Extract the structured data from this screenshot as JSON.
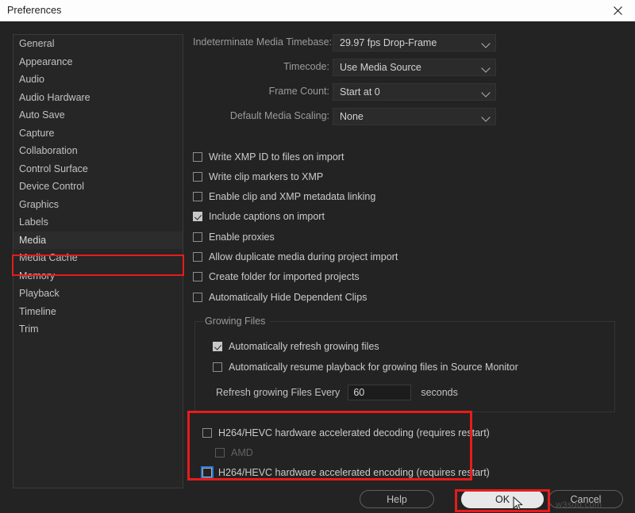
{
  "window": {
    "title": "Preferences",
    "close_icon": "close-icon"
  },
  "sidebar": {
    "items": [
      {
        "label": "General"
      },
      {
        "label": "Appearance"
      },
      {
        "label": "Audio"
      },
      {
        "label": "Audio Hardware"
      },
      {
        "label": "Auto Save"
      },
      {
        "label": "Capture"
      },
      {
        "label": "Collaboration"
      },
      {
        "label": "Control Surface"
      },
      {
        "label": "Device Control"
      },
      {
        "label": "Graphics"
      },
      {
        "label": "Labels"
      },
      {
        "label": "Media"
      },
      {
        "label": "Media Cache"
      },
      {
        "label": "Memory"
      },
      {
        "label": "Playback"
      },
      {
        "label": "Timeline"
      },
      {
        "label": "Trim"
      }
    ],
    "selected": "Media"
  },
  "fields": [
    {
      "label": "Indeterminate Media Timebase:",
      "value": "29.97 fps Drop-Frame"
    },
    {
      "label": "Timecode:",
      "value": "Use Media Source"
    },
    {
      "label": "Frame Count:",
      "value": "Start at 0"
    },
    {
      "label": "Default Media Scaling:",
      "value": "None"
    }
  ],
  "checkboxes": [
    {
      "label": "Write XMP ID to files on import",
      "checked": false
    },
    {
      "label": "Write clip markers to XMP",
      "checked": false
    },
    {
      "label": "Enable clip and XMP metadata linking",
      "checked": false
    },
    {
      "label": "Include captions on import",
      "checked": true
    },
    {
      "label": "Enable proxies",
      "checked": false
    },
    {
      "label": "Allow duplicate media during project import",
      "checked": false
    },
    {
      "label": "Create folder for imported projects",
      "checked": false
    },
    {
      "label": "Automatically Hide Dependent Clips",
      "checked": false
    }
  ],
  "growing_files": {
    "title": "Growing Files",
    "checkboxes": [
      {
        "label": "Automatically refresh growing files",
        "checked": true
      },
      {
        "label": "Automatically resume playback for growing files in Source Monitor",
        "checked": false
      }
    ],
    "refresh_label": "Refresh growing Files Every",
    "refresh_value": "60",
    "refresh_placeholder": "60",
    "seconds_label": "seconds"
  },
  "hardware": [
    {
      "label": "H264/HEVC hardware accelerated decoding (requires restart)",
      "checked": false,
      "disabled": false,
      "focused": false
    },
    {
      "label": "AMD",
      "checked": false,
      "disabled": true,
      "focused": false
    },
    {
      "label": "H264/HEVC hardware accelerated encoding (requires restart)",
      "checked": false,
      "disabled": false,
      "focused": true
    }
  ],
  "footer": {
    "help_label": "Help",
    "ok_label": "OK",
    "cancel_label": "Cancel"
  },
  "annotations": {
    "media_highlight_color": "#e81b1b",
    "hardware_highlight_color": "#e81b1b",
    "ok_highlight_color": "#e81b1b",
    "focus_color": "#2b77d6"
  },
  "watermark": {
    "text": "w3sdd.com"
  }
}
